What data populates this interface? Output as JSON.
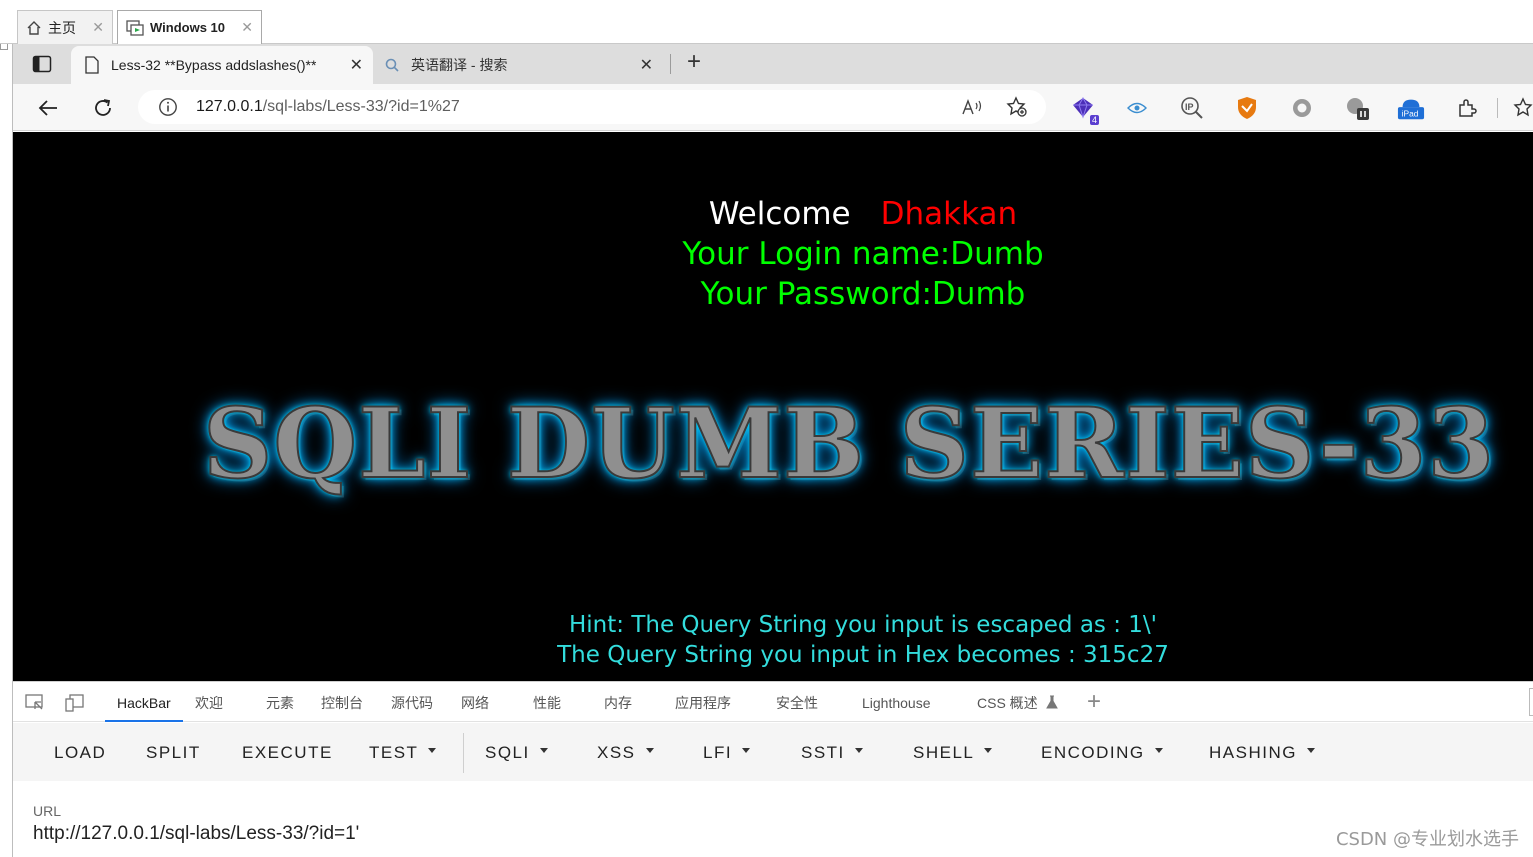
{
  "vm_tabs": [
    {
      "label": "主页",
      "icon": "home-icon"
    },
    {
      "label": "Windows 10",
      "icon": "vm-icon"
    }
  ],
  "browser": {
    "tabs": [
      {
        "title": "Less-32 **Bypass addslashes()**",
        "active": true
      },
      {
        "title": "英语翻译 - 搜索",
        "active": false
      }
    ],
    "address": {
      "host": "127.0.0.1",
      "path": "/sql-labs/Less-33/?id=1%27"
    },
    "extensions": [
      {
        "name": "gem-extension-icon",
        "badge": "4"
      },
      {
        "name": "eye-extension-icon"
      },
      {
        "name": "ip-extension-icon"
      },
      {
        "name": "shield-extension-icon"
      },
      {
        "name": "circle-extension-icon"
      },
      {
        "name": "puzzle-badge-extension-icon"
      },
      {
        "name": "ipad-extension-icon",
        "label": "iPad"
      },
      {
        "name": "extensions-icon"
      },
      {
        "name": "favorites-icon"
      }
    ]
  },
  "page": {
    "welcome": "Welcome",
    "user_tag": "Dhakkan",
    "login_name": "Your Login name:Dumb",
    "password": "Your Password:Dumb",
    "banner": "SQLI DUMB SERIES-33",
    "hint1": "Hint: The Query String you input is escaped as : 1\\'",
    "hint2": "The Query String you input in Hex becomes : 315c27"
  },
  "devtools": {
    "tabs": [
      "HackBar",
      "欢迎",
      "元素",
      "控制台",
      "源代码",
      "网络",
      "性能",
      "内存",
      "应用程序",
      "安全性",
      "Lighthouse",
      "CSS 概述"
    ],
    "active_tab": "HackBar"
  },
  "hackbar": {
    "buttons": [
      "LOAD",
      "SPLIT",
      "EXECUTE",
      "TEST",
      "SQLI",
      "XSS",
      "LFI",
      "SSTI",
      "SHELL",
      "ENCODING",
      "HASHING"
    ],
    "url_label": "URL",
    "url_value": "http://127.0.0.1/sql-labs/Less-33/?id=1'"
  },
  "watermark": "CSDN @专业划水选手",
  "colors": {
    "welcome": "#ffffff",
    "user_tag": "#ff0000",
    "login": "#00ff00",
    "hint": "#33dddd",
    "devtools_active": "#1a73e8"
  }
}
